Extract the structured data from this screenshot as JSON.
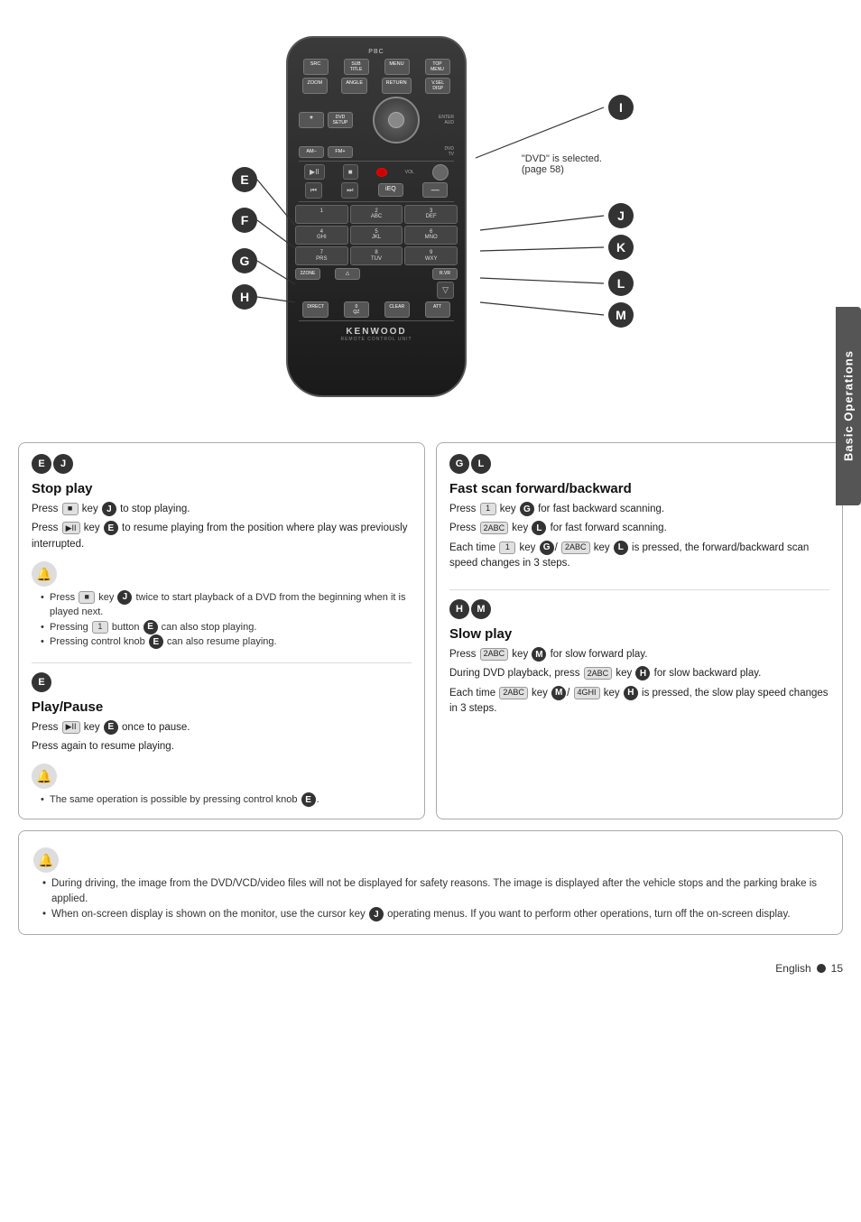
{
  "side_tab": {
    "label": "Basic Operations"
  },
  "remote": {
    "brand": "KENWOOD",
    "brand_sub": "REMOTE CONTROL UNIT",
    "top_label": "PBC",
    "buttons_row1": [
      "SRC",
      "SUB TITLE",
      "MENU",
      "TOP MENU"
    ],
    "buttons_row2": [
      "ZOOM",
      "ANGLE",
      "RETURN",
      "V.SEL DISP"
    ],
    "enter_label": "ENTER",
    "aud_label": "AUD",
    "dvd_setup": "DVD SETUP",
    "am_minus": "AM–",
    "fm_plus": "FM+",
    "dvd_tv": "DVD TV",
    "vol_label": "VOL",
    "transport": [
      "⏮",
      "⏭",
      "⏸▶",
      "⏹",
      "●"
    ],
    "equalizer": "iEQ",
    "numbers": [
      {
        "num": "1",
        "sub": ""
      },
      {
        "num": "2 ABC",
        "sub": ""
      },
      {
        "num": "3 DEF",
        "sub": ""
      },
      {
        "num": "4 GHI",
        "sub": ""
      },
      {
        "num": "5 JKL",
        "sub": ""
      },
      {
        "num": "6 MNO",
        "sub": ""
      },
      {
        "num": "7 PRS",
        "sub": ""
      },
      {
        "num": "8 TUV",
        "sub": ""
      },
      {
        "num": "9 WXY",
        "sub": ""
      }
    ],
    "zone_btn": "2ZONE",
    "eject": "△",
    "rvr": "R.VR",
    "arrow_down": "▽",
    "bottom_row": [
      "DIRECT",
      "0 QZ",
      "CLEAR",
      "ATT"
    ]
  },
  "dvd_note": {
    "text": "\"DVD\" is selected.",
    "page_ref": "(page 58)"
  },
  "labels": {
    "E": "E",
    "F": "F",
    "G": "G",
    "H": "H",
    "I": "I",
    "J": "J",
    "K": "K",
    "L": "L",
    "M": "M"
  },
  "stop_play": {
    "labels": [
      "E",
      "J"
    ],
    "title": "Stop play",
    "line1_prefix": "Press",
    "line1_key": "■",
    "line1_mid": "key",
    "line1_circle": "J",
    "line1_suffix": "to stop playing.",
    "line2_prefix": "Press",
    "line2_key": "▶II",
    "line2_mid": "key",
    "line2_circle": "E",
    "line2_suffix": "to resume playing from the position where play was previously interrupted.",
    "bullets": [
      "Press ■ key ● twice to start playback of a DVD from the beginning when it is played next.",
      "Pressing 1 button ● can also stop playing.",
      "Pressing control knob ● can also resume playing."
    ]
  },
  "play_pause": {
    "label": "E",
    "title": "Play/Pause",
    "line1_prefix": "Press",
    "line1_key": "▶II",
    "line1_mid": "key",
    "line1_circle": "E",
    "line1_suffix": "once to pause.",
    "line2": "Press again to resume playing.",
    "bullet": "The same operation is possible by pressing control knob ●."
  },
  "fast_scan": {
    "labels": [
      "G",
      "L"
    ],
    "title": "Fast scan forward/backward",
    "lines": [
      {
        "prefix": "Press",
        "key": "1",
        "mid": "key",
        "circle": "G",
        "suffix": "for fast backward scanning."
      },
      {
        "prefix": "Press",
        "key": "2ABC",
        "mid": "key",
        "circle": "L",
        "suffix": "for fast forward scanning."
      },
      {
        "text": "Each time"
      },
      {
        "suffix": "key G/ key L is pressed, the forward/backward scan speed changes in 3 steps."
      }
    ],
    "line1": "Press [1] key G for fast backward scanning.",
    "line2": "Press [2ABC] key L for fast forward scanning.",
    "line3": "Each time [1] key G/ [2ABC] key L is pressed, the forward/backward scan speed changes in 3 steps."
  },
  "slow_play": {
    "labels": [
      "H",
      "M"
    ],
    "title": "Slow play",
    "line1": "Press [2ABC] key M for slow forward play.",
    "line2": "During DVD playback, press [2ABC] key H for slow backward play.",
    "line3": "Each time [2ABC] key M/ [4GHI] key H is pressed, the slow play speed changes in 3 steps."
  },
  "bottom_note": {
    "bullets": [
      "During driving, the image from the DVD/VCD/video files will not be displayed for safety reasons. The image is displayed after the vehicle stops and the parking brake is applied.",
      "When on-screen display is shown on the monitor, use the cursor key ● operating menus. If you want to perform other operations, turn off the on-screen display."
    ]
  },
  "footer": {
    "lang": "English",
    "page": "15"
  }
}
